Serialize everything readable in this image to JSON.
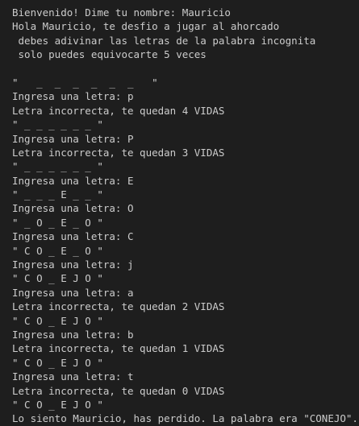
{
  "terminal": {
    "lines": [
      "Bienvenido! Dime tu nombre: Mauricio",
      "Hola Mauricio, te desfio a jugar al ahorcado",
      " debes adivinar las letras de la palabra incognita",
      " solo puedes equivocarte 5 veces",
      "",
      "\"   _  _  _  _  _  _   \"",
      "Ingresa una letra: p",
      "Letra incorrecta, te quedan 4 VIDAS",
      "\" _ _ _ _ _ _ \"",
      "Ingresa una letra: P",
      "Letra incorrecta, te quedan 3 VIDAS",
      "\" _ _ _ _ _ _ \"",
      "Ingresa una letra: E",
      "\" _ _ _ E _ _ \"",
      "Ingresa una letra: O",
      "\" _ O _ E _ O \"",
      "Ingresa una letra: C",
      "\" C O _ E _ O \"",
      "Ingresa una letra: j",
      "\" C O _ E J O \"",
      "Ingresa una letra: a",
      "Letra incorrecta, te quedan 2 VIDAS",
      "\" C O _ E J O \"",
      "Ingresa una letra: b",
      "Letra incorrecta, te quedan 1 VIDAS",
      "\" C O _ E J O \"",
      "Ingresa una letra: t",
      "Letra incorrecta, te quedan 0 VIDAS",
      "\" C O _ E J O \"",
      "Lo siento Mauricio, has perdido. La palabra era \"CONEJO\"."
    ]
  }
}
